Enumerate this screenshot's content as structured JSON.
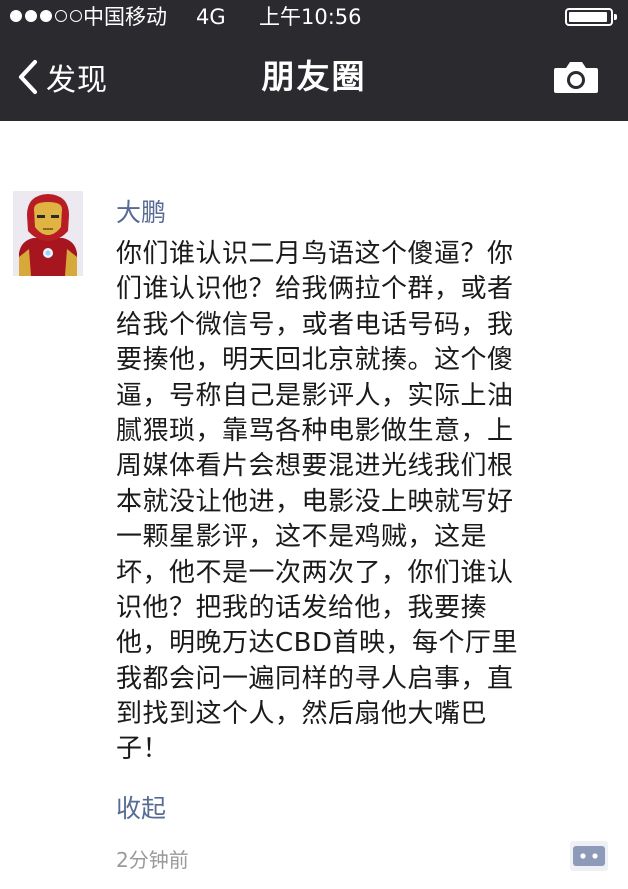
{
  "status_bar": {
    "signal_dots_filled": 3,
    "signal_dots_total": 5,
    "carrier": "中国移动",
    "network": "4G",
    "time": "上午10:56",
    "battery_level": 0.95
  },
  "nav_bar": {
    "back_label": "发现",
    "title": "朋友圈",
    "back_icon": "chevron-left-icon",
    "right_icon": "camera-icon"
  },
  "post": {
    "author": "大鹏",
    "avatar_icon": "iron-man-avatar",
    "content_lines": [
      "你们谁认识二月鸟语这个傻逼？你",
      "们谁认识他？给我俩拉个群，或者",
      "给我个微信号，或者电话号码，我",
      "要揍他，明天回北京就揍。这个傻",
      "逼，号称自己是影评人，实际上油",
      "腻猥琐，靠骂各种电影做生意，上",
      "周媒体看片会想要混进光线我们根",
      "本就没让他进，电影没上映就写好",
      "一颗星影评，这不是鸡贼，这是",
      "坏，他不是一次两次了，你们谁认",
      "识他？把我的话发给他，我要揍",
      "他，明晚万达CBD首映，每个厅里",
      "我都会问一遍同样的寻人启事，直",
      "到找到这个人，然后扇他大嘴巴",
      "子！"
    ],
    "collapse_label": "收起",
    "timestamp": "2分钟前",
    "comment_icon": "comment-icon"
  },
  "colors": {
    "nav_background": "#2b2b2f",
    "link_blue": "#576b95",
    "timestamp_gray": "#9a9a9a",
    "comment_button": "#8e9bb8"
  }
}
